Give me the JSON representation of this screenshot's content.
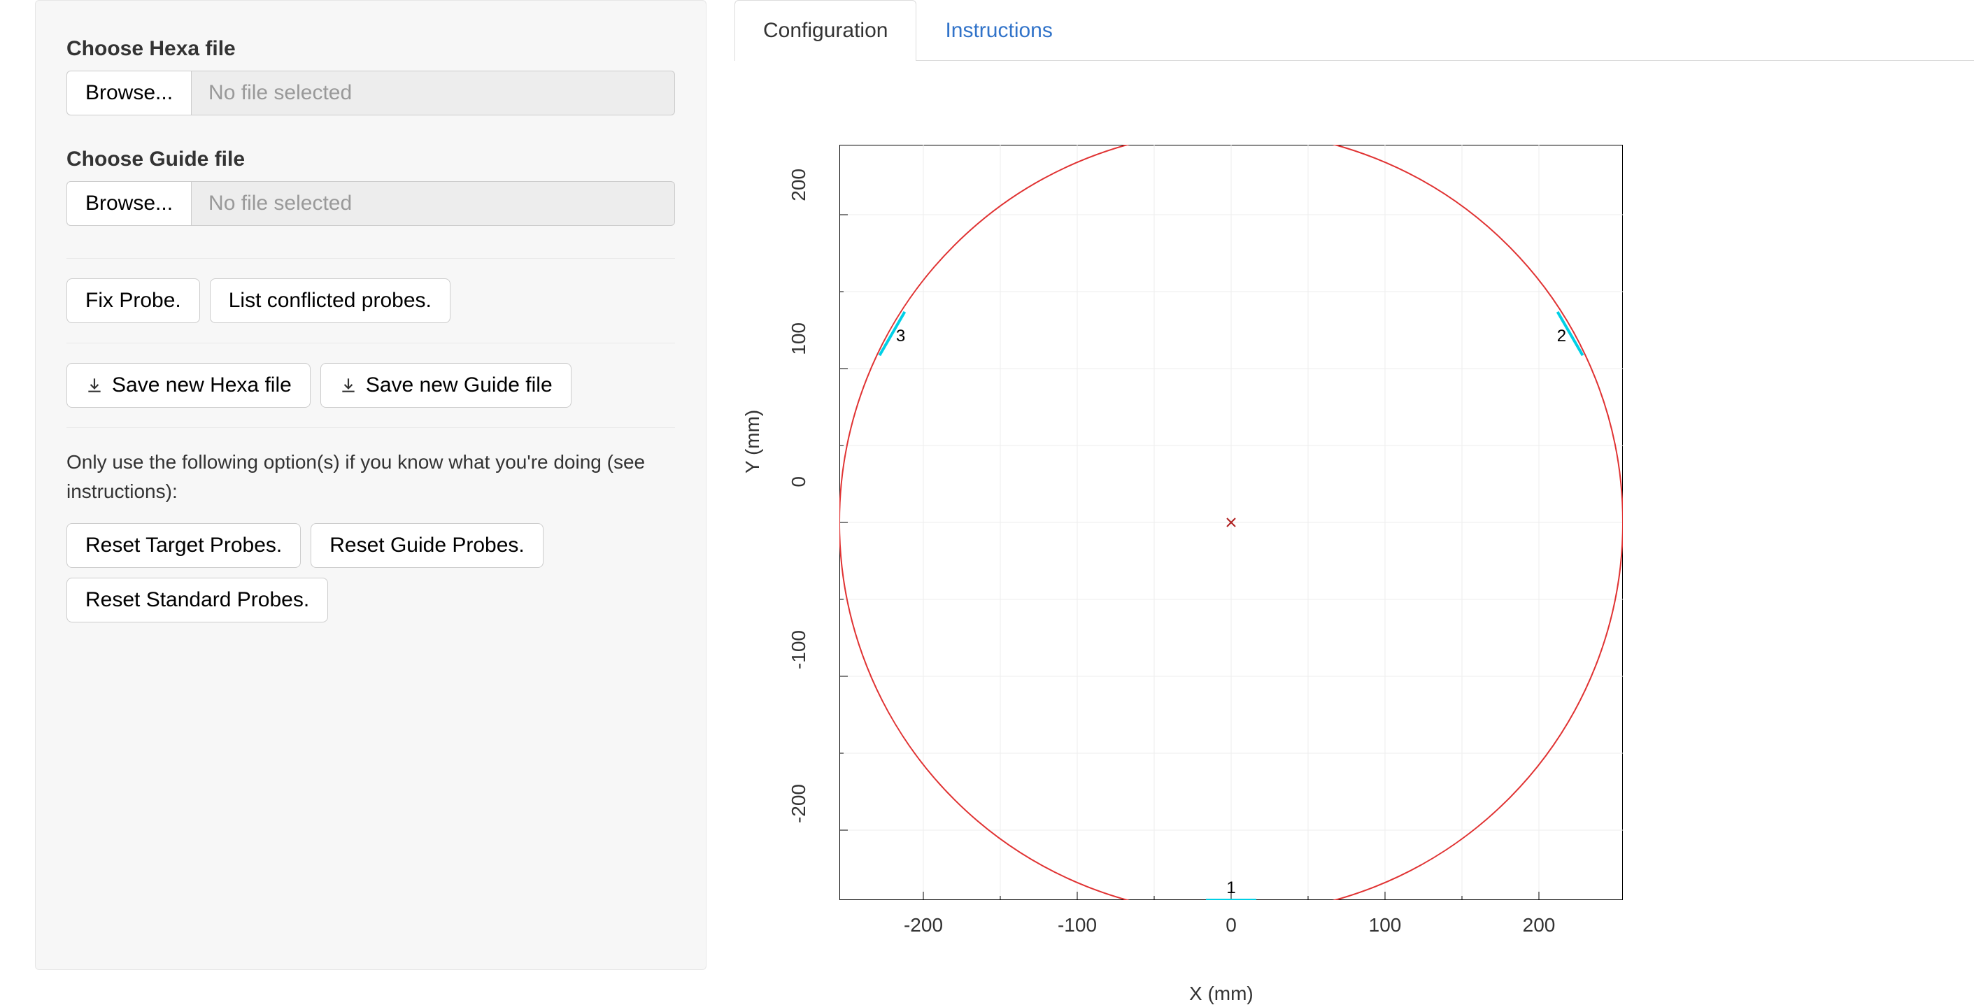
{
  "sidebar": {
    "hexa_label": "Choose Hexa file",
    "guide_label": "Choose Guide file",
    "browse": "Browse...",
    "no_file": "No file selected",
    "fix_probe": "Fix Probe.",
    "list_conflict": "List conflicted probes.",
    "save_hexa": "Save new Hexa file",
    "save_guide": "Save new Guide file",
    "warning": "Only use the following option(s) if you know what you're doing (see instructions):",
    "reset_target": "Reset Target Probes.",
    "reset_guide": "Reset Guide Probes.",
    "reset_standard": "Reset Standard Probes."
  },
  "tabs": {
    "config": "Configuration",
    "instr": "Instructions"
  },
  "axes": {
    "xlabel": "X (mm)",
    "ylabel": "Y (mm)",
    "yticks": [
      "200",
      "100",
      "0",
      "-100",
      "-200"
    ],
    "xticks": [
      "-200",
      "-100",
      "0",
      "100",
      "200"
    ]
  },
  "chart_data": {
    "type": "scatter",
    "title": "",
    "xlabel": "X (mm)",
    "ylabel": "Y (mm)",
    "xlim": [
      -260,
      260
    ],
    "ylim": [
      -260,
      260
    ],
    "field_circle": {
      "cx": 0,
      "cy": 0,
      "r": 260
    },
    "center_marker": {
      "x": 0,
      "y": 0
    },
    "probes": [
      {
        "id": "1",
        "x": 0,
        "y": -260,
        "angle_deg": 270
      },
      {
        "id": "2",
        "x": 225,
        "y": 130,
        "angle_deg": 30
      },
      {
        "id": "3",
        "x": -225,
        "y": 130,
        "angle_deg": 150
      }
    ]
  }
}
